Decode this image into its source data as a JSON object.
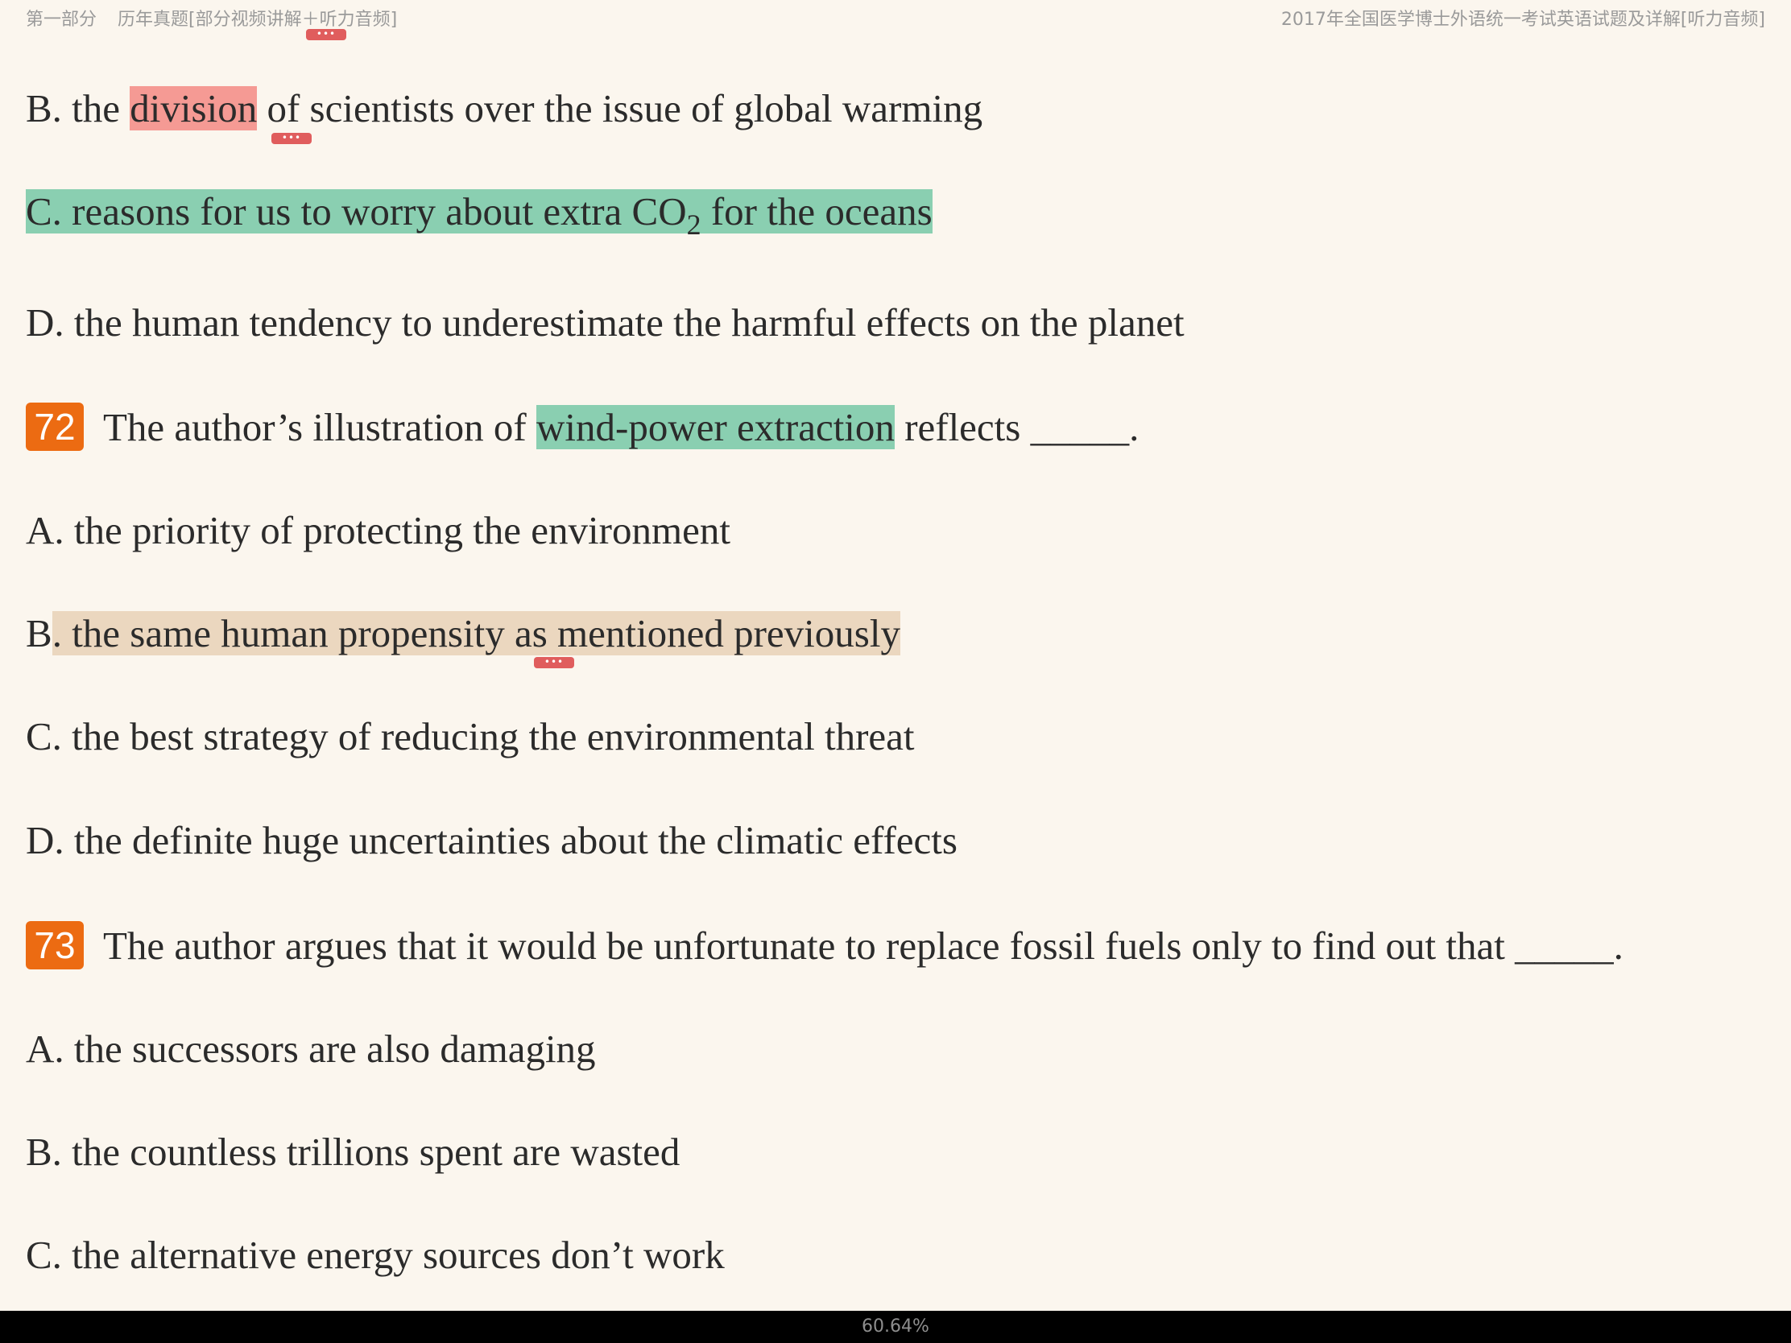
{
  "header": {
    "part": "第一部分",
    "section": "历年真题[部分视频讲解＋听力音频]",
    "book_title": "2017年全国医学博士外语统一考试英语试题及详解[听力音频]"
  },
  "note_marker": "•••",
  "q71_options": {
    "b_pre": "B. the ",
    "b_hl": "division",
    "b_post": " of scientists over the issue of global warming",
    "c_main": "C. reasons for us to worry about extra CO",
    "c_sub": "2",
    "c_post": " for the oceans",
    "d": "D. the human tendency to underestimate the harmful effects on the planet"
  },
  "q72": {
    "number": "72",
    "pre": "The author’s illustration of ",
    "hl": "wind-power extraction",
    "post": " reflects _____.",
    "a": "A. the priority of protecting the environment",
    "b_pre": "B",
    "b_hl": ". the same human propensity as mentioned previously",
    "c": "C. the best strategy of reducing the environmental threat",
    "d": "D. the definite huge uncertainties about the climatic effects"
  },
  "q73": {
    "number": "73",
    "stem": "The author argues that it would be unfortunate to replace fossil fuels only to find out that _____.",
    "a": "A. the successors are also damaging",
    "b": "B. the countless trillions spent are wasted",
    "c": "C. the alternative energy sources don’t work"
  },
  "footer": {
    "progress": "60.64%"
  },
  "colors": {
    "background": "#FBF6EE",
    "highlight_red": "#F59A94",
    "highlight_green": "#8ACFB1",
    "highlight_tan": "#EBD7BF",
    "question_badge": "#EC6B12",
    "note_marker": "#E05D5D"
  }
}
